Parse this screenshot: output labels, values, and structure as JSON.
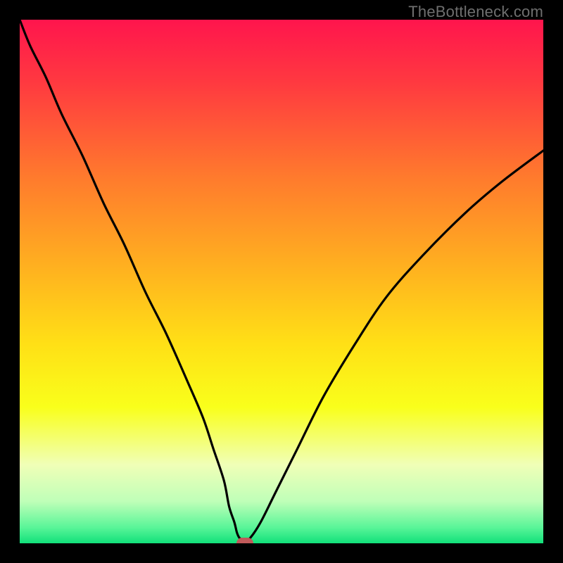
{
  "watermark": "TheBottleneck.com",
  "chart_data": {
    "type": "line",
    "title": "",
    "xlabel": "",
    "ylabel": "",
    "xlim": [
      0,
      100
    ],
    "ylim": [
      0,
      100
    ],
    "background_gradient_stops": [
      {
        "pct": 0,
        "color": "#ff154d"
      },
      {
        "pct": 12,
        "color": "#ff3940"
      },
      {
        "pct": 30,
        "color": "#ff7a2d"
      },
      {
        "pct": 48,
        "color": "#ffb31f"
      },
      {
        "pct": 62,
        "color": "#ffe016"
      },
      {
        "pct": 74,
        "color": "#f9ff1b"
      },
      {
        "pct": 85,
        "color": "#f0ffb7"
      },
      {
        "pct": 92,
        "color": "#bfffb8"
      },
      {
        "pct": 97,
        "color": "#59f598"
      },
      {
        "pct": 100,
        "color": "#11e07a"
      }
    ],
    "series": [
      {
        "name": "bottleneck-curve",
        "x": [
          0,
          2,
          5,
          8,
          12,
          16,
          20,
          24,
          28,
          32,
          35,
          37,
          39,
          40,
          41,
          41.5,
          42,
          43,
          44,
          46,
          49,
          53,
          58,
          64,
          70,
          77,
          85,
          92,
          100
        ],
        "values": [
          100,
          95,
          89,
          82,
          74,
          65,
          57,
          48,
          40,
          31,
          24,
          18,
          12,
          7,
          4,
          2,
          1,
          0.5,
          1,
          4,
          10,
          18,
          28,
          38,
          47,
          55,
          63,
          69,
          75
        ]
      }
    ],
    "marker": {
      "x": 43,
      "y": 0,
      "label": "optimal-point"
    }
  }
}
